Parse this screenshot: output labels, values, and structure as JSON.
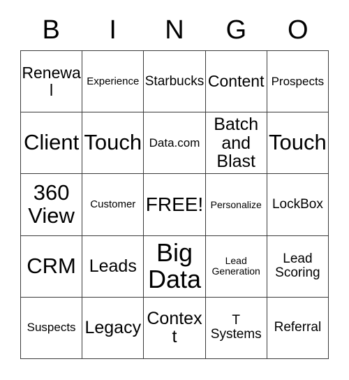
{
  "card": {
    "title": "BINGO",
    "header_letters": [
      "B",
      "I",
      "N",
      "G",
      "O"
    ],
    "colors": {
      "background": "#ffffff",
      "text": "#000000",
      "grid_line": "#3a3a3a"
    },
    "columns": 5,
    "rows": 5,
    "free_space": "FREE!",
    "cells": [
      {
        "text": "Renewal",
        "size": "fs-l"
      },
      {
        "text": "Experience",
        "size": "fs-s"
      },
      {
        "text": "Starbucks",
        "size": "fs-m"
      },
      {
        "text": "Content",
        "size": "fs-l"
      },
      {
        "text": "Prospects",
        "size": "fs-sm"
      },
      {
        "text": "Client",
        "size": "fs-h"
      },
      {
        "text": "Touch",
        "size": "fs-h"
      },
      {
        "text": "Data.com",
        "size": "fs-sm"
      },
      {
        "text": "Batch\nand\nBlast",
        "size": "fs-xl"
      },
      {
        "text": "Touch",
        "size": "fs-h"
      },
      {
        "text": "360\nView",
        "size": "fs-h"
      },
      {
        "text": "Customer",
        "size": "fs-s"
      },
      {
        "text": "FREE!",
        "size": "fs-xxl"
      },
      {
        "text": "Personalize",
        "size": "fs-xs"
      },
      {
        "text": "LockBox",
        "size": "fs-m"
      },
      {
        "text": "CRM",
        "size": "fs-h"
      },
      {
        "text": "Leads",
        "size": "fs-xl"
      },
      {
        "text": "Big\nData",
        "size": "fs-hh"
      },
      {
        "text": "Lead\nGeneration",
        "size": "fs-xs"
      },
      {
        "text": "Lead\nScoring",
        "size": "fs-m"
      },
      {
        "text": "Suspects",
        "size": "fs-sm"
      },
      {
        "text": "Legacy",
        "size": "fs-xl"
      },
      {
        "text": "Context",
        "size": "fs-xl"
      },
      {
        "text": "T\nSystems",
        "size": "fs-m"
      },
      {
        "text": "Referral",
        "size": "fs-m"
      }
    ]
  }
}
